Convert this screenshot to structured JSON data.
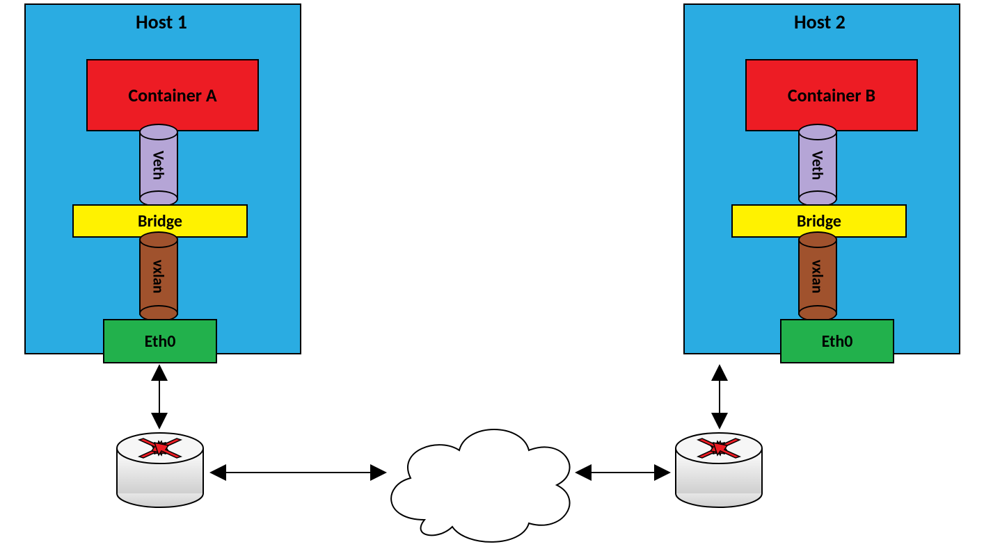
{
  "hosts": [
    {
      "title": "Host 1",
      "container": "Container A",
      "veth": "Veth",
      "bridge": "Bridge",
      "vxlan": "vxlan",
      "eth": "Eth0"
    },
    {
      "title": "Host 2",
      "container": "Container B",
      "veth": "Veth",
      "bridge": "Bridge",
      "vxlan": "vxlan",
      "eth": "Eth0"
    }
  ],
  "colors": {
    "host_bg": "#2aace2",
    "container_bg": "#ed1c24",
    "bridge_bg": "#fff200",
    "eth_bg": "#22b14c",
    "veth_bg": "#b5a5d6",
    "vxlan_bg": "#a0522d",
    "router_arrow": "#ed1c24"
  }
}
